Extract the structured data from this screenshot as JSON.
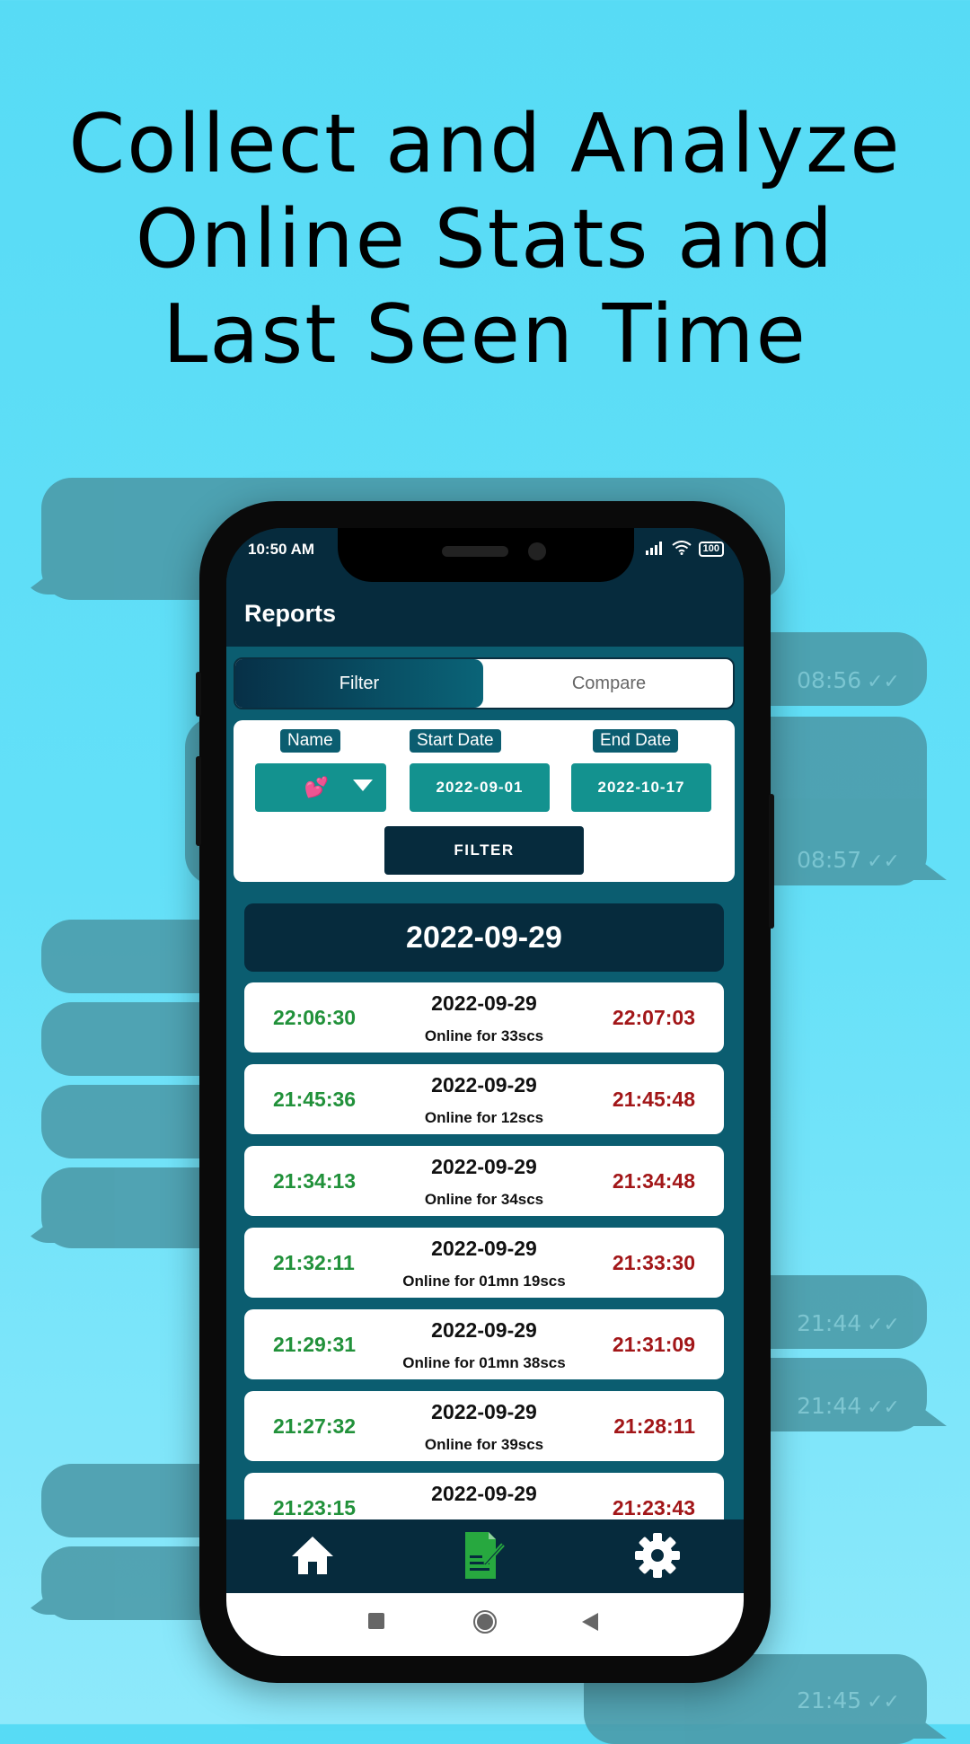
{
  "headline": [
    "Collect and Analyze",
    "Online Stats and",
    "Last Seen Time"
  ],
  "background_bubbles": [
    {
      "time": "08:56"
    },
    {
      "time": "08:57"
    },
    {
      "time": "21:44"
    },
    {
      "time": "21:44"
    },
    {
      "time": "21:45"
    }
  ],
  "status_bar": {
    "time": "10:50 AM",
    "battery": "100"
  },
  "app_bar": {
    "title": "Reports"
  },
  "tabs": [
    {
      "label": "Filter",
      "active": true
    },
    {
      "label": "Compare",
      "active": false
    }
  ],
  "filter": {
    "name_label": "Name",
    "name_value": "💕",
    "start_label": "Start Date",
    "start_value": "2022-09-01",
    "end_label": "End Date",
    "end_value": "2022-10-17",
    "button": "FILTER"
  },
  "group_date": "2022-09-29",
  "sessions": [
    {
      "start": "22:06:30",
      "date": "2022-09-29",
      "duration": "Online for 33scs",
      "end": "22:07:03"
    },
    {
      "start": "21:45:36",
      "date": "2022-09-29",
      "duration": "Online for 12scs",
      "end": "21:45:48"
    },
    {
      "start": "21:34:13",
      "date": "2022-09-29",
      "duration": "Online for 34scs",
      "end": "21:34:48"
    },
    {
      "start": "21:32:11",
      "date": "2022-09-29",
      "duration": "Online for 01mn 19scs",
      "end": "21:33:30"
    },
    {
      "start": "21:29:31",
      "date": "2022-09-29",
      "duration": "Online for 01mn 38scs",
      "end": "21:31:09"
    },
    {
      "start": "21:27:32",
      "date": "2022-09-29",
      "duration": "Online for 39scs",
      "end": "21:28:11"
    },
    {
      "start": "21:23:15",
      "date": "2022-09-29",
      "duration": "",
      "end": "21:23:43"
    }
  ],
  "bottom_nav": [
    {
      "icon": "home-icon",
      "active": false
    },
    {
      "icon": "report-icon",
      "active": true
    },
    {
      "icon": "gear-icon",
      "active": false
    }
  ],
  "colors": {
    "start_time": "#21913a",
    "end_time": "#a21618",
    "active_nav": "#27a83f"
  }
}
